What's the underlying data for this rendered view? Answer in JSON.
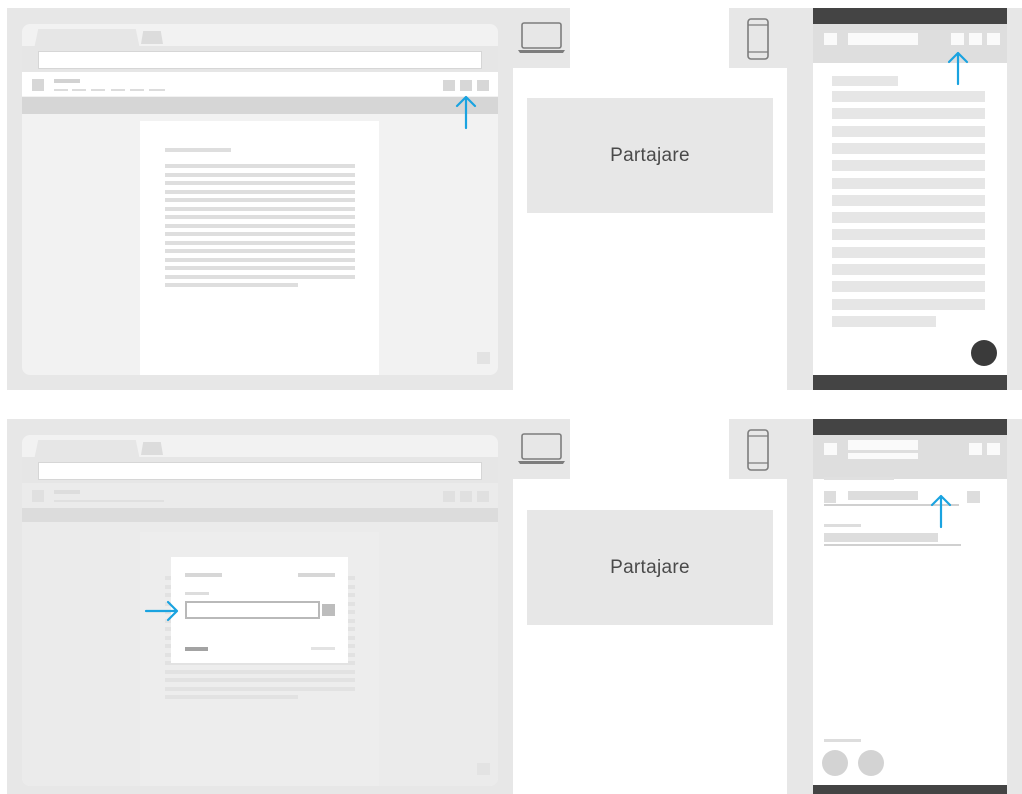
{
  "labels": {
    "share_top": "Partajare",
    "share_bottom": "Partajare"
  },
  "icons": {
    "laptop": "laptop-icon",
    "phone": "phone-icon",
    "arrow": "arrow-icon"
  },
  "colors": {
    "arrow": "#1aa3e0",
    "panel_bg": "#e7e7e7",
    "phone_bar": "#444444",
    "fab": "#3a3a3a"
  }
}
